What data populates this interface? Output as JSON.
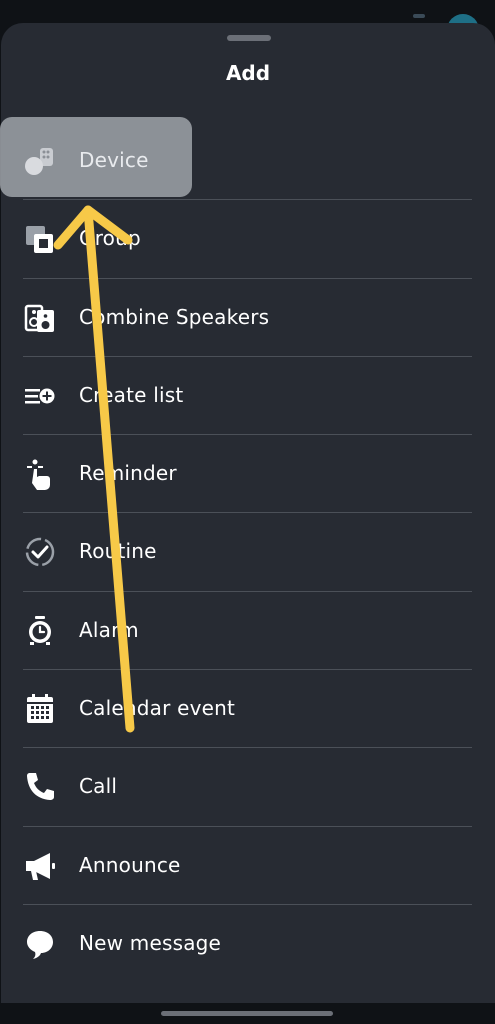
{
  "sheet": {
    "title": "Add"
  },
  "menu": {
    "items": [
      {
        "label": "Device",
        "icon": "device-icon"
      },
      {
        "label": "Group",
        "icon": "group-icon"
      },
      {
        "label": "Combine Speakers",
        "icon": "speakers-icon"
      },
      {
        "label": "Create list",
        "icon": "create-list-icon"
      },
      {
        "label": "Reminder",
        "icon": "reminder-icon"
      },
      {
        "label": "Routine",
        "icon": "routine-icon"
      },
      {
        "label": "Alarm",
        "icon": "alarm-icon"
      },
      {
        "label": "Calendar event",
        "icon": "calendar-icon"
      },
      {
        "label": "Call",
        "icon": "phone-icon"
      },
      {
        "label": "Announce",
        "icon": "megaphone-icon"
      },
      {
        "label": "New message",
        "icon": "message-icon"
      }
    ]
  },
  "colors": {
    "sheet_background": "#272b33",
    "highlight": "#9fa3a9",
    "arrow": "#f7c948",
    "text": "#ffffff"
  }
}
